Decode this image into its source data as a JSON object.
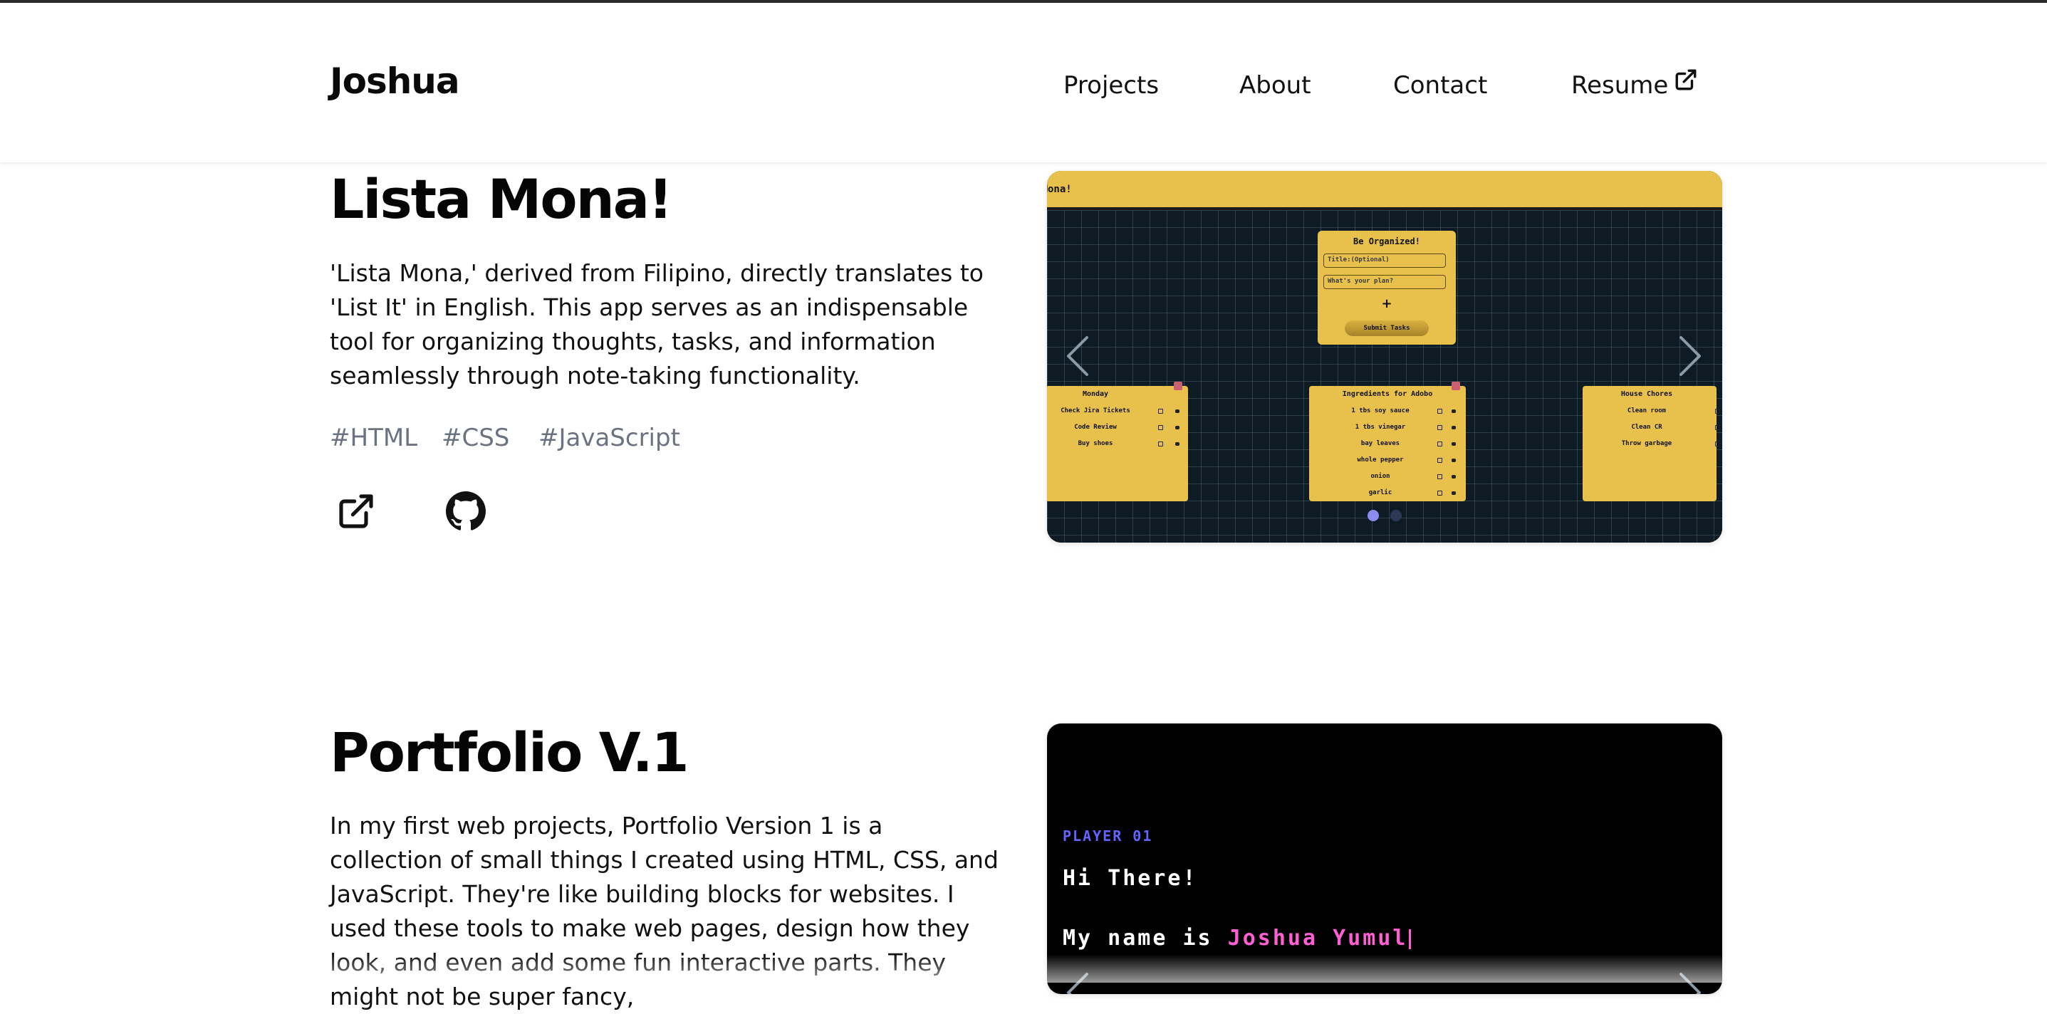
{
  "header": {
    "logo": "Joshua",
    "nav": {
      "projects": "Projects",
      "about": "About",
      "contact": "Contact",
      "resume": "Resume"
    }
  },
  "projects": [
    {
      "title": "Lista Mona!",
      "description": "'Lista Mona,' derived from Filipino, directly translates to 'List It' in English. This app serves as an indispensable tool for organizing thoughts, tasks, and information seamlessly through note-taking functionality.",
      "tags": [
        "#HTML",
        "#CSS",
        "#JavaScript"
      ],
      "links": [
        "external-link-icon",
        "github-icon"
      ],
      "preview": {
        "app_title": "Lista Mona!",
        "form": {
          "title": "Be Organized!",
          "title_placeholder": "Title:(Optional)",
          "plan_placeholder": "What's your plan?",
          "plus": "+",
          "submit": "Submit Tasks"
        },
        "notes": [
          {
            "title": "Monday",
            "items": [
              "Check Jira Tickets",
              "Code Review",
              "Buy shoes"
            ]
          },
          {
            "title": "Ingredients for Adobo",
            "items": [
              "1 tbs soy sauce",
              "1 tbs vinegar",
              "bay leaves",
              "whole pepper",
              "onion",
              "garlic"
            ]
          },
          {
            "title": "House Chores",
            "items": [
              "Clean room",
              "Clean CR",
              "Throw garbage"
            ]
          }
        ],
        "active_slide": 1,
        "slide_count": 2
      }
    },
    {
      "title": "Portfolio V.1",
      "description": "In my first web projects, Portfolio Version 1 is a collection of small things I created using HTML, CSS, and JavaScript. They're like building blocks for websites. I used these tools to make web pages, design how they look, and even add some fun interactive parts. They might not be super fancy,",
      "preview": {
        "player": "PLAYER 01",
        "greeting": "Hi There!",
        "name_prefix": "My name is ",
        "name": "Joshua Yumul"
      }
    }
  ],
  "colors": {
    "accent_yellow": "#e8c04c",
    "tag_gray": "#6b7280",
    "terminal_purple": "#6363ff",
    "terminal_pink": "#ff5fd2",
    "dot_active": "#8b8cf2"
  }
}
